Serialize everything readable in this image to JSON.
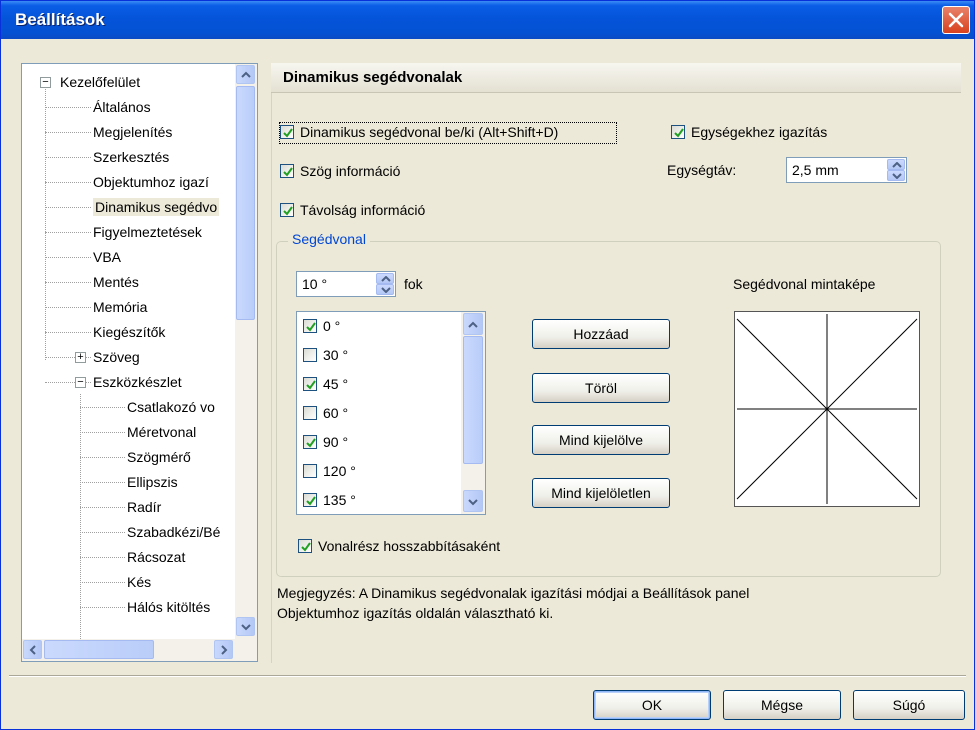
{
  "window": {
    "title": "Beállítások"
  },
  "tree": {
    "items": [
      {
        "label": "Kezelőfelület",
        "level": 0,
        "expander": "−"
      },
      {
        "label": "Általános",
        "level": 1
      },
      {
        "label": "Megjelenítés",
        "level": 1
      },
      {
        "label": "Szerkesztés",
        "level": 1
      },
      {
        "label": "Objektumhoz igazí",
        "level": 1
      },
      {
        "label": "Dinamikus segédvo",
        "level": 1,
        "selected": true
      },
      {
        "label": "Figyelmeztetések",
        "level": 1
      },
      {
        "label": "VBA",
        "level": 1
      },
      {
        "label": "Mentés",
        "level": 1
      },
      {
        "label": "Memória",
        "level": 1
      },
      {
        "label": "Kiegészítők",
        "level": 1
      },
      {
        "label": "Szöveg",
        "level": 1,
        "expander": "+"
      },
      {
        "label": "Eszközkészlet",
        "level": 1,
        "expander": "−"
      },
      {
        "label": "Csatlakozó vo",
        "level": 2
      },
      {
        "label": "Méretvonal",
        "level": 2
      },
      {
        "label": "Szögmérő",
        "level": 2
      },
      {
        "label": "Ellipszis",
        "level": 2
      },
      {
        "label": "Radír",
        "level": 2
      },
      {
        "label": "Szabadkézi/Bé",
        "level": 2
      },
      {
        "label": "Rácsozat",
        "level": 2
      },
      {
        "label": "Kés",
        "level": 2
      },
      {
        "label": "Hálós kitöltés",
        "level": 2
      }
    ]
  },
  "section": {
    "title": "Dinamikus segédvonalak"
  },
  "options": {
    "dynamic_toggle": {
      "label": "Dinamikus segédvonal be/ki (Alt+Shift+D)",
      "checked": true
    },
    "angle_info": {
      "label": "Szög információ",
      "checked": true
    },
    "distance_info": {
      "label": "Távolság információ",
      "checked": true
    },
    "unit_snap": {
      "label": "Egységekhez igazítás",
      "checked": true
    },
    "unit_distance_label": "Egységtáv:",
    "unit_distance_value": "2,5 mm"
  },
  "guide_group": {
    "legend": "Segédvonal",
    "angle_value": "10 °",
    "angle_unit": "fok",
    "angles": [
      {
        "label": "0 °",
        "checked": true
      },
      {
        "label": "30 °",
        "checked": false
      },
      {
        "label": "45 °",
        "checked": true
      },
      {
        "label": "60 °",
        "checked": false
      },
      {
        "label": "90 °",
        "checked": true
      },
      {
        "label": "120 °",
        "checked": false
      },
      {
        "label": "135 °",
        "checked": true
      }
    ],
    "add_button": "Hozzáad",
    "delete_button": "Töröl",
    "select_all_button": "Mind kijelölve",
    "deselect_all_button": "Mind kijelöletlen",
    "preview_title": "Segédvonal mintaképe",
    "extension": {
      "label": "Vonalrész hosszabbításaként",
      "checked": true
    }
  },
  "note": {
    "line1": "Megjegyzés: A Dinamikus segédvonalak igazítási módjai a Beállítások panel",
    "line2": "Objektumhoz igazítás oldalán választható ki."
  },
  "footer": {
    "ok": "OK",
    "cancel": "Mégse",
    "help": "Súgó"
  },
  "colors": {
    "titlebar": "#0453d8",
    "accent_legend": "#0046d5",
    "face": "#ece9d8"
  }
}
